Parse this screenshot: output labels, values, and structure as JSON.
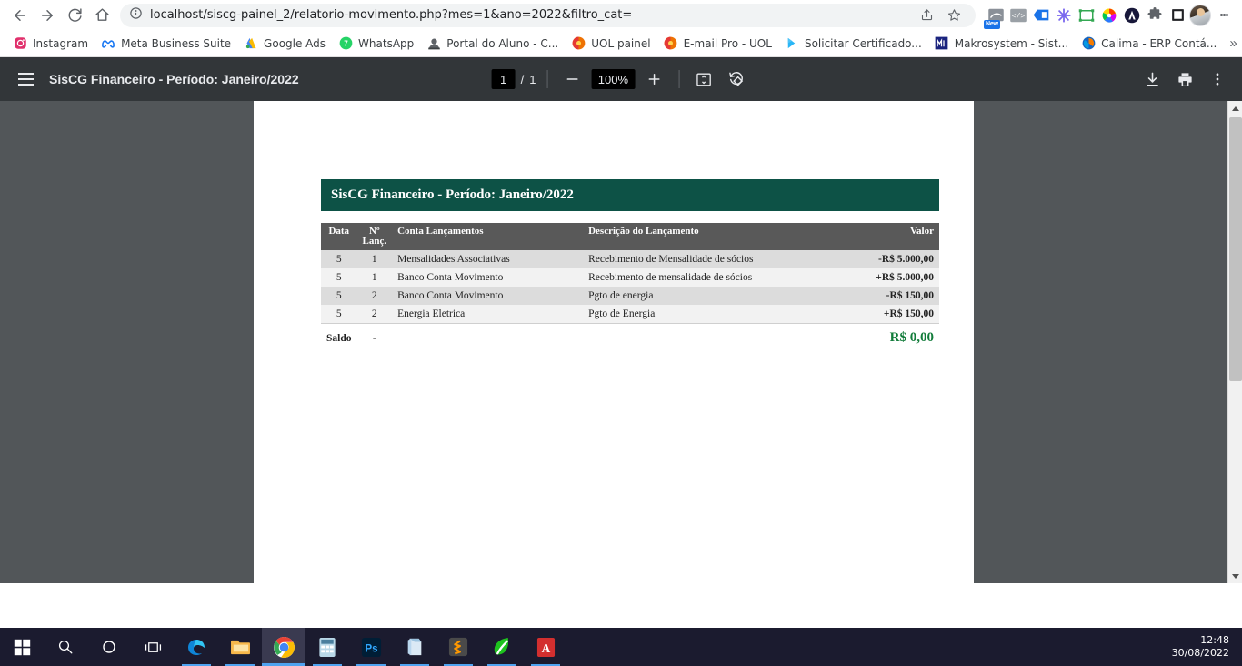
{
  "browser": {
    "url": "localhost/siscg-painel_2/relatorio-movimento.php?mes=1&ano=2022&filtro_cat=",
    "nav": {
      "back_label": "Back",
      "forward_label": "Forward",
      "reload_label": "Reload",
      "home_label": "Home"
    },
    "omnibox_actions": [
      {
        "name": "share-icon",
        "label": "Share"
      },
      {
        "name": "bookmark-star-icon",
        "label": "Bookmark this tab"
      }
    ],
    "extensions": [
      {
        "name": "screenshot-extension-icon",
        "label": "Screenshot",
        "badge": "New",
        "color": "#8a9098"
      },
      {
        "name": "code-extension-icon",
        "label": "Code viewer",
        "badge": "",
        "color": "#9aa0a6"
      },
      {
        "name": "blue-tag-extension-icon",
        "label": "Tag tool",
        "badge": "",
        "color": "#1a73e8"
      },
      {
        "name": "asterisk-extension-icon",
        "label": "Asterisk tool",
        "badge": "",
        "color": "#7b68ee"
      },
      {
        "name": "capture-frame-extension-icon",
        "label": "Capture area",
        "badge": "",
        "color": "#34a853"
      },
      {
        "name": "color-wheel-extension-icon",
        "label": "Color picker",
        "badge": "",
        "color": "#ff6d00"
      },
      {
        "name": "avast-extension-icon",
        "label": "Avast",
        "badge": "",
        "color": "#1b1b3a"
      },
      {
        "name": "puzzle-extensions-icon",
        "label": "Extensions",
        "badge": "",
        "color": "#5f6368"
      },
      {
        "name": "white-square-extension-icon",
        "label": "Reader",
        "badge": "",
        "color": "#202124"
      }
    ],
    "profile_label": "Profile",
    "menu_label": "Customize and control Google Chrome",
    "bookmarks": [
      {
        "label": "Instagram",
        "icon": "instagram-icon",
        "color": "#e1306c"
      },
      {
        "label": "Meta Business Suite",
        "icon": "meta-icon",
        "color": "#1877f2"
      },
      {
        "label": "Google Ads",
        "icon": "google-ads-icon",
        "color": "#4285f4"
      },
      {
        "label": "WhatsApp",
        "icon": "whatsapp-icon",
        "color": "#25d366"
      },
      {
        "label": "Portal do Aluno - C...",
        "icon": "portal-aluno-icon",
        "color": "#555555"
      },
      {
        "label": "UOL painel",
        "icon": "uol-icon",
        "color": "#ee7203"
      },
      {
        "label": "E-mail Pro - UOL",
        "icon": "uol-mail-icon",
        "color": "#ee7203"
      },
      {
        "label": "Solicitar Certificado...",
        "icon": "certificado-icon",
        "color": "#29b6f6"
      },
      {
        "label": "Makrosystem - Sist...",
        "icon": "makrosystem-icon",
        "color": "#1a237e"
      },
      {
        "label": "Calima - ERP Contá...",
        "icon": "calima-icon",
        "color": "#f57c00"
      }
    ],
    "bookmarks_overflow_label": "»"
  },
  "pdf_viewer": {
    "title": "SisCG Financeiro - Período: Janeiro/2022",
    "menu_label": "Menu",
    "page_current": "1",
    "page_separator": "/",
    "page_total": "1",
    "zoom_out_label": "Zoom out",
    "zoom_value": "100%",
    "zoom_in_label": "Zoom in",
    "fit_page_label": "Fit to page",
    "rotate_label": "Rotate counterclockwise",
    "download_label": "Download",
    "print_label": "Print",
    "more_label": "More actions"
  },
  "report": {
    "title": "SisCG Financeiro - Período: Janeiro/2022",
    "accent_color": "#0d5246",
    "header_bg": "#595959",
    "positive_color": "#127c3a",
    "negative_color": "#cc0000",
    "columns": [
      "Data",
      "Nº Lanç.",
      "Conta Lançamentos",
      "Descrição do Lançamento",
      "Valor"
    ],
    "column_header_lines": {
      "num_lanc_line1": "Nº",
      "num_lanc_line2": "Lanç."
    },
    "rows": [
      {
        "data": "5",
        "num": "1",
        "conta": "Mensalidades Associativas",
        "descricao": "Recebimento de Mensalidade de sócios",
        "valor": "-R$ 5.000,00",
        "sign": "neg"
      },
      {
        "data": "5",
        "num": "1",
        "conta": "Banco Conta Movimento",
        "descricao": "Recebimento de mensalidade de sócios",
        "valor": "+R$ 5.000,00",
        "sign": "pos"
      },
      {
        "data": "5",
        "num": "2",
        "conta": "Banco Conta Movimento",
        "descricao": "Pgto de energia",
        "valor": "-R$ 150,00",
        "sign": "neg"
      },
      {
        "data": "5",
        "num": "2",
        "conta": "Energia Eletrica",
        "descricao": "Pgto de Energia",
        "valor": "+R$ 150,00",
        "sign": "pos"
      }
    ],
    "footer": {
      "label": "Saldo",
      "num": "-",
      "conta": "",
      "descricao": "",
      "valor": "R$ 0,00"
    }
  },
  "taskbar": {
    "items": [
      {
        "name": "start-button",
        "label": "Start",
        "icon": "windows-logo-icon"
      },
      {
        "name": "search-button",
        "label": "Search",
        "icon": "search-icon"
      },
      {
        "name": "cortana-button",
        "label": "Cortana",
        "icon": "cortana-circle-icon"
      },
      {
        "name": "task-view-button",
        "label": "Task View",
        "icon": "task-view-icon"
      },
      {
        "name": "taskbar-edge",
        "label": "Microsoft Edge",
        "icon": "edge-icon"
      },
      {
        "name": "taskbar-file-explorer",
        "label": "File Explorer",
        "icon": "folder-icon"
      },
      {
        "name": "taskbar-chrome",
        "label": "Google Chrome",
        "icon": "chrome-icon"
      },
      {
        "name": "taskbar-calculator",
        "label": "Calculator",
        "icon": "calculator-icon"
      },
      {
        "name": "taskbar-photoshop",
        "label": "Adobe Photoshop",
        "icon": "photoshop-icon"
      },
      {
        "name": "taskbar-notes",
        "label": "Notes",
        "icon": "notes-icon"
      },
      {
        "name": "taskbar-sublime",
        "label": "Sublime Text",
        "icon": "sublime-icon"
      },
      {
        "name": "taskbar-greenapp",
        "label": "Green app",
        "icon": "green-leaf-icon"
      },
      {
        "name": "taskbar-acrobat",
        "label": "Adobe Acrobat",
        "icon": "acrobat-icon"
      }
    ],
    "clock_time": "12:48",
    "clock_date": "30/08/2022"
  }
}
